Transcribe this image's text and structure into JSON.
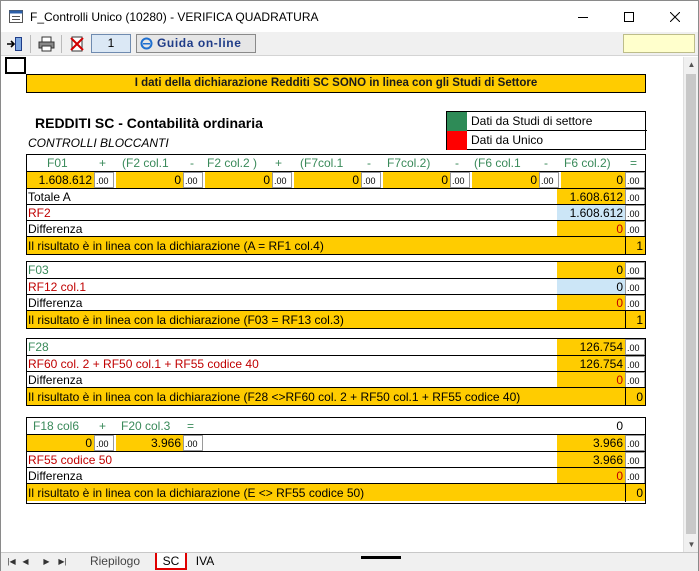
{
  "window": {
    "title": "F_Controlli Unico (10280) - VERIFICA QUADRATURA"
  },
  "toolbar": {
    "page_number": "1",
    "help_label": "Guida on-line"
  },
  "banner": "I dati della dichiarazione  Redditi  SC  SONO in linea con gli Studi di Settore",
  "header": {
    "title": "REDDITI SC - Contabilità ordinaria",
    "subtitle": "CONTROLLI BLOCCANTI"
  },
  "legend": {
    "studi_label": "Dati da Studi di settore",
    "studi_color": "#2e8b57",
    "unico_label": "Dati da Unico",
    "unico_color": "#ff0000"
  },
  "block1": {
    "formula": [
      "F01",
      "+",
      "(F2 col.1",
      "-",
      "F2 col.2 )",
      "+",
      "(F7col.1",
      "-",
      "F7col.2)",
      "-",
      "(F6 col.1",
      "-",
      "F6 col.2)",
      "="
    ],
    "values": [
      "1.608.612",
      "0",
      "0",
      "0",
      "0",
      "0",
      "0"
    ],
    "dec": ".00",
    "totale_label": "Totale A",
    "totale_value": "1.608.612",
    "rf2_label": "RF2",
    "rf2_value": "1.608.612",
    "diff_label": "Differenza",
    "diff_value": "0",
    "result_label": "Il risultato è in linea con la dichiarazione (A = RF1 col.4)",
    "result_value": "1"
  },
  "block2": {
    "f03_label": "F03",
    "f03_value": "0",
    "rf12_label": "RF12 col.1",
    "rf12_value": "0",
    "diff_label": "Differenza",
    "diff_value": "0",
    "result_label": "Il risultato è in linea con la dichiarazione (F03 = RF13 col.3)",
    "result_value": "1"
  },
  "block3": {
    "f28_label": "F28",
    "f28_value": "126.754",
    "rf60_label": "RF60 col. 2 + RF50 col.1 + RF55 codice 40",
    "rf60_value": "126.754",
    "diff_label": "Differenza",
    "diff_value": "0",
    "result_label": "Il risultato è in linea con la dichiarazione (F28 <>RF60 col. 2 + RF50 col.1 + RF55 codice 40)",
    "result_value": "0"
  },
  "block4": {
    "formula": [
      "F18 col6",
      "+",
      "F20 col.3",
      "="
    ],
    "formula_value": "0",
    "values": [
      "0",
      "3.966"
    ],
    "sum_value": "3.966",
    "rf55_label": "RF55 codice 50",
    "rf55_value": "3.966",
    "diff_label": "Differenza",
    "diff_value": "0",
    "result_label": "Il risultato è in linea con la dichiarazione (E <> RF55 codice 50)",
    "result_value": "0"
  },
  "tabs": [
    "Riepilogo",
    "SC",
    "IVA"
  ]
}
